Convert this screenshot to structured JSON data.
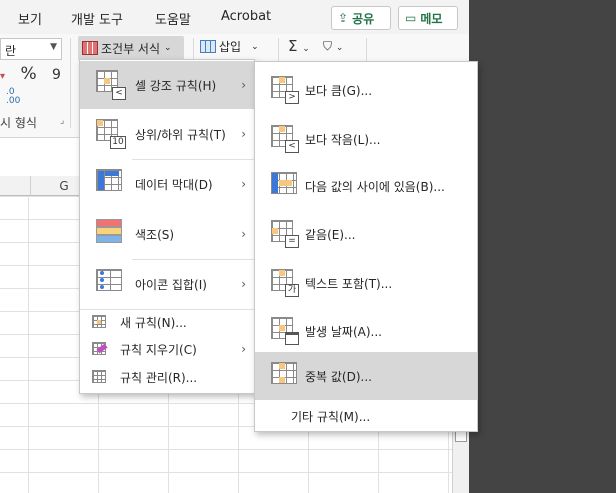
{
  "tabs": [
    "보기",
    "개발 도구",
    "도움말",
    "Acrobat"
  ],
  "share_label": "공유",
  "memo_label": "메모",
  "ribbon": {
    "font_combo_value": "란",
    "percent_symbol": "%",
    "comma_symbol": "9",
    "decimal_top": ".0",
    "decimal_bottom": ".00",
    "number_group_label": "시 형식",
    "conditional_format_label": "조건부 서식",
    "insert_label": "삽입",
    "sum_symbol": "Σ"
  },
  "sheet": {
    "visible_column": "G"
  },
  "menu1": {
    "big_items": [
      {
        "label": "셀 강조 규칙(H)",
        "has_submenu": true,
        "highlighted": true
      },
      {
        "label": "상위/하위 규칙(T)",
        "has_submenu": true
      },
      {
        "label": "데이터 막대(D)",
        "has_submenu": true
      },
      {
        "label": "색조(S)",
        "has_submenu": true
      },
      {
        "label": "아이콘 집합(I)",
        "has_submenu": true
      }
    ],
    "small_items": [
      {
        "label": "새 규칙(N)..."
      },
      {
        "label": "규칙 지우기(C)",
        "has_submenu": true
      },
      {
        "label": "규칙 관리(R)..."
      }
    ],
    "badge_10": "10"
  },
  "menu2": {
    "items": [
      {
        "label": "보다 큼(G)...",
        "badge": ">"
      },
      {
        "label": "보다 작음(L)...",
        "badge": "<"
      },
      {
        "label": "다음 값의 사이에 있음(B)...",
        "badge": ""
      },
      {
        "label": "같음(E)...",
        "badge": "="
      },
      {
        "label": "텍스트 포함(T)...",
        "badge": "가"
      },
      {
        "label": "발생 날짜(A)...",
        "badge": ""
      },
      {
        "label": "중복 값(D)...",
        "badge": "",
        "highlighted": true
      }
    ],
    "more_rules": "기타 규칙(M)..."
  },
  "colors": {
    "accent_green": "#217346",
    "menu_highlight": "#d7d7d7",
    "cell_highlight": "#f8c77e",
    "dark_background": "#444444"
  }
}
